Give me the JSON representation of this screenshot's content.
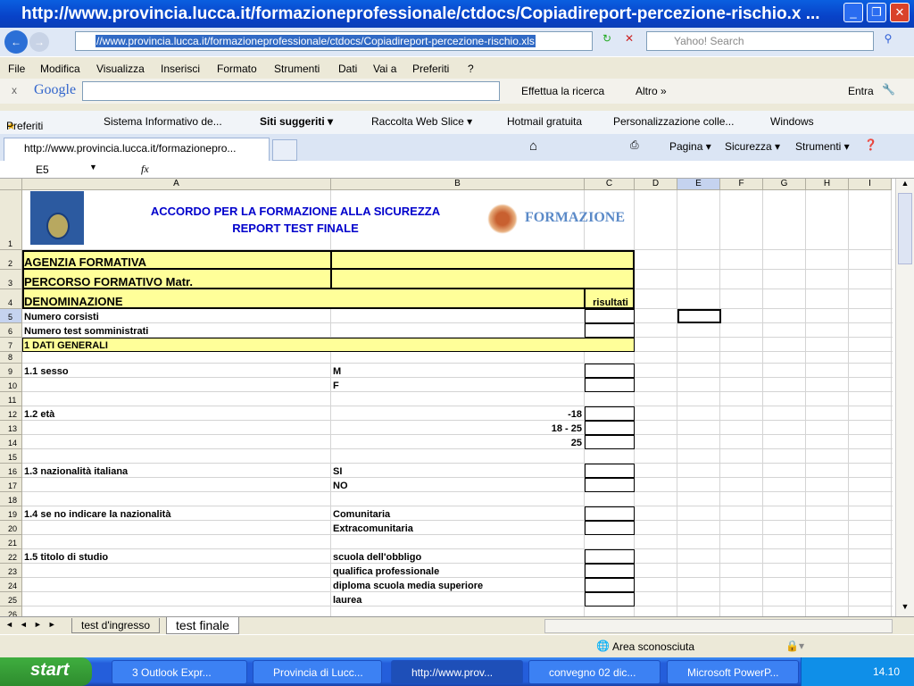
{
  "window": {
    "title": "http://www.provincia.lucca.it/formazioneprofessionale/ctdocs/Copiadireport-percezione-rischio.x ..."
  },
  "nav": {
    "address": "//www.provincia.lucca.it/formazioneprofessionale/ctdocs/Copiadireport-percezione-rischio.xls",
    "search_placeholder": "Yahoo! Search"
  },
  "menu": [
    "File",
    "Modifica",
    "Visualizza",
    "Inserisci",
    "Formato",
    "Strumenti",
    "Dati",
    "Vai a",
    "Preferiti",
    "?"
  ],
  "google": {
    "close": "x",
    "logo": "Google",
    "search_btn": "Effettua la ricerca",
    "more": "Altro »",
    "signin": "Entra"
  },
  "favorites": [
    "Preferiti",
    "Sistema Informativo de...",
    "Siti suggeriti ▾",
    "Raccolta Web Slice ▾",
    "Hotmail gratuita",
    "Personalizzazione colle...",
    "Windows"
  ],
  "tab": {
    "title": "http://www.provincia.lucca.it/formazionepro..."
  },
  "commands": [
    "Pagina ▾",
    "Sicurezza ▾",
    "Strumenti ▾"
  ],
  "formula": {
    "cell_ref": "E5",
    "fx": "fx",
    "value": ""
  },
  "sheet": {
    "columns": [
      "A",
      "B",
      "C",
      "D",
      "E",
      "F",
      "G",
      "H",
      "I"
    ],
    "selected_cell": "E5",
    "logo_text": "PROVINCIA di Lucca",
    "title1": "ACCORDO PER LA FORMAZIONE ALLA SICUREZZA",
    "title2": "REPORT TEST FINALE",
    "brand": "FORMAZIONE",
    "rows": [
      {
        "n": "1",
        "a": "",
        "b": "",
        "c": ""
      },
      {
        "n": "2",
        "a": "AGENZIA FORMATIVA",
        "b": "",
        "c": ""
      },
      {
        "n": "3",
        "a": "PERCORSO FORMATIVO Matr.",
        "b": "",
        "c": ""
      },
      {
        "n": "4",
        "a": "DENOMINAZIONE",
        "b": "",
        "c": "risultati"
      },
      {
        "n": "5",
        "a": "Numero corsisti",
        "b": "",
        "c": ""
      },
      {
        "n": "6",
        "a": "Numero test somministrati",
        "b": "",
        "c": ""
      },
      {
        "n": "7",
        "a": "1 DATI GENERALI",
        "b": "",
        "c": ""
      },
      {
        "n": "8",
        "a": "",
        "b": "",
        "c": ""
      },
      {
        "n": "9",
        "a": "1.1 sesso",
        "b": "M",
        "c": ""
      },
      {
        "n": "10",
        "a": "",
        "b": "F",
        "c": ""
      },
      {
        "n": "11",
        "a": "",
        "b": "",
        "c": ""
      },
      {
        "n": "12",
        "a": "1.2 età",
        "b": "-18",
        "c": ""
      },
      {
        "n": "13",
        "a": "",
        "b": "18 - 25",
        "c": ""
      },
      {
        "n": "14",
        "a": "",
        "b": "25",
        "c": ""
      },
      {
        "n": "15",
        "a": "",
        "b": "",
        "c": ""
      },
      {
        "n": "16",
        "a": "1.3 nazionalità italiana",
        "b": "SI",
        "c": ""
      },
      {
        "n": "17",
        "a": "",
        "b": "NO",
        "c": ""
      },
      {
        "n": "18",
        "a": "",
        "b": "",
        "c": ""
      },
      {
        "n": "19",
        "a": "1.4 se no  indicare la nazionalità",
        "b": "Comunitaria",
        "c": ""
      },
      {
        "n": "20",
        "a": "",
        "b": "Extracomunitaria",
        "c": ""
      },
      {
        "n": "21",
        "a": "",
        "b": "",
        "c": ""
      },
      {
        "n": "22",
        "a": "1.5 titolo di studio",
        "b": "scuola dell'obbligo",
        "c": ""
      },
      {
        "n": "23",
        "a": "",
        "b": "qualifica professionale",
        "c": ""
      },
      {
        "n": "24",
        "a": "",
        "b": "diploma scuola media superiore",
        "c": ""
      },
      {
        "n": "25",
        "a": "",
        "b": "laurea",
        "c": ""
      },
      {
        "n": "26",
        "a": "",
        "b": "",
        "c": ""
      }
    ],
    "tabs": [
      "test d'ingresso",
      "test finale"
    ],
    "active_tab": "test finale",
    "title_color": "#0000cc",
    "yellow": "#ffff99"
  },
  "status": {
    "zone": "Area sconosciuta"
  },
  "taskbar": {
    "start": "start",
    "tasks": [
      "3 Outlook Expr...",
      "Provincia di Lucc...",
      "http://www.prov...",
      "convegno 02 dic...",
      "Microsoft PowerP..."
    ],
    "clock": "14.10"
  }
}
